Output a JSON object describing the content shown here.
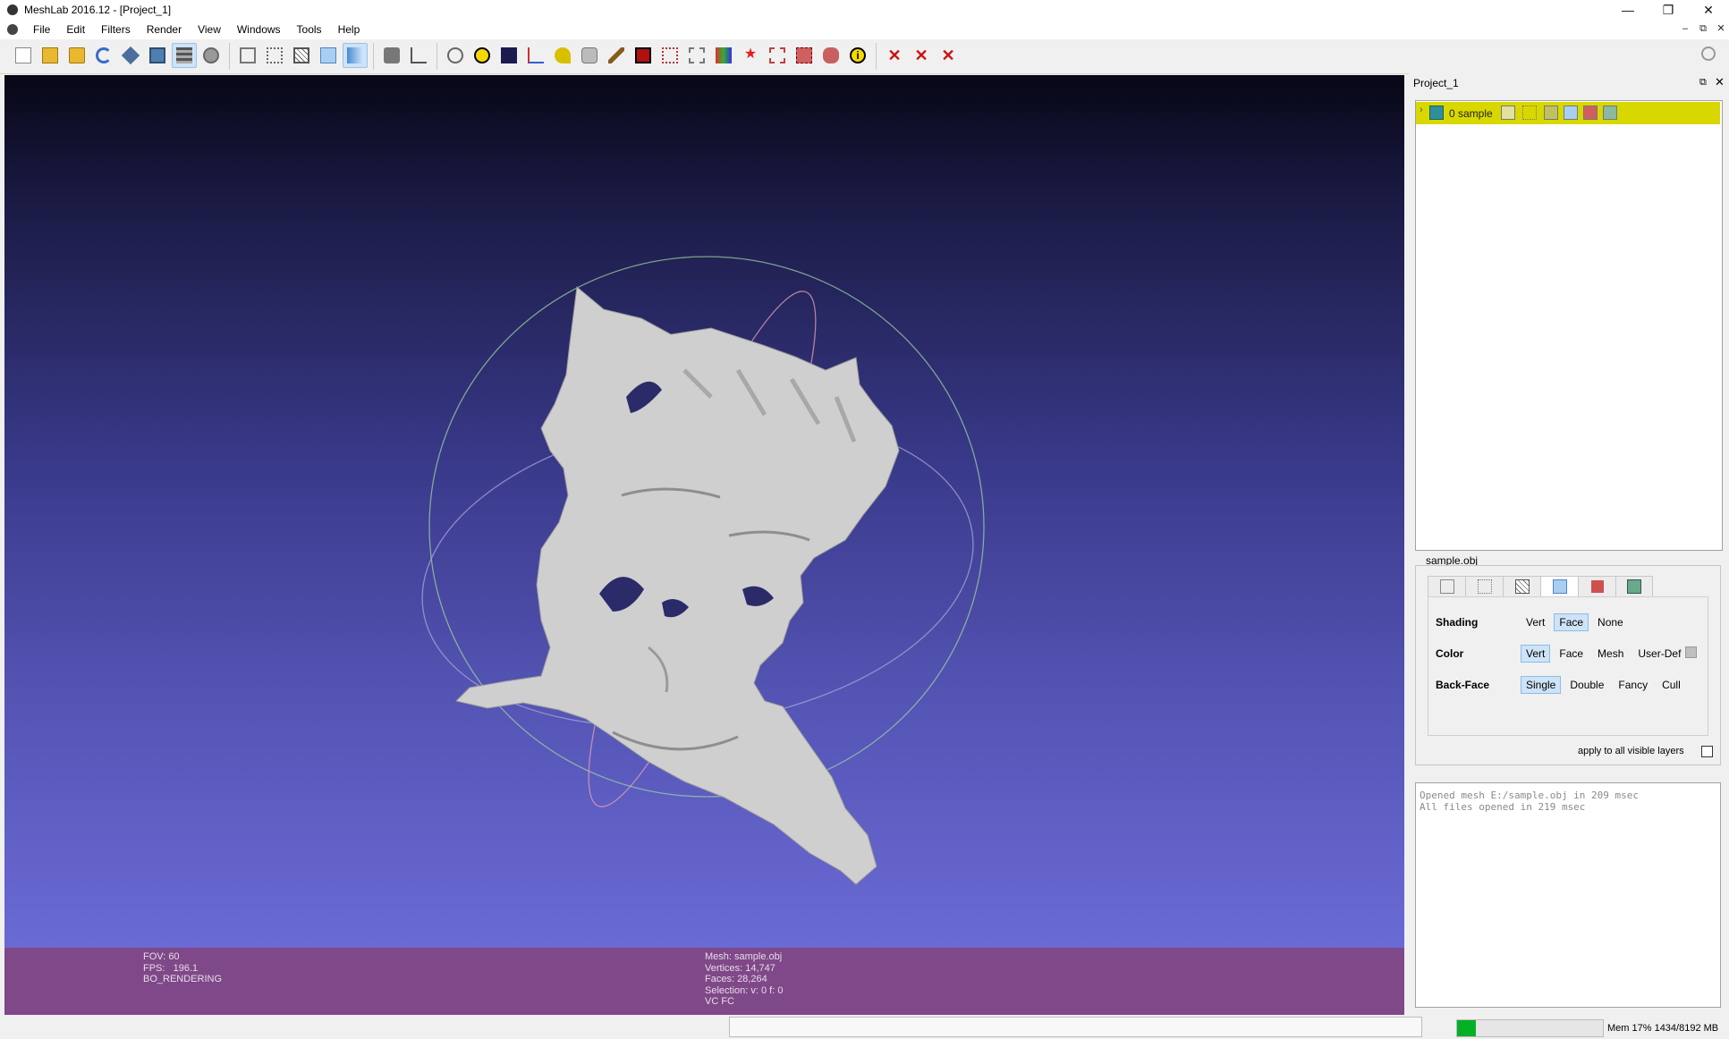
{
  "window": {
    "title": "MeshLab 2016.12 - [Project_1]",
    "minimize": "—",
    "restore": "❐",
    "close": "✕"
  },
  "menu": {
    "items": [
      "File",
      "Edit",
      "Filters",
      "Render",
      "View",
      "Windows",
      "Tools",
      "Help"
    ],
    "mdi_min": "–",
    "mdi_restore": "⧉",
    "mdi_close": "✕"
  },
  "toolbar": {
    "group1": [
      "new-project",
      "open-project",
      "import-mesh",
      "reload",
      "export-mesh",
      "snapshot",
      "show-layers",
      "show-raster"
    ],
    "group2": [
      "bbox",
      "points",
      "wireframe",
      "flat-lines",
      "flat",
      "smooth"
    ],
    "group3": [
      "light",
      "axis"
    ],
    "group4": [
      "trackball",
      "annotate",
      "shader",
      "axes",
      "paint-select",
      "measure",
      "brush",
      "pickpoints",
      "align",
      "align2",
      "texture",
      "georef",
      "select-vertex",
      "select-face",
      "select-connected",
      "select-conn2",
      "info"
    ],
    "group5": [
      "delete-v",
      "delete-f",
      "delete-all"
    ],
    "active": [
      "show-layers",
      "flat",
      "smooth"
    ]
  },
  "viewport": {
    "hud_left": [
      "FOV: 60",
      "FPS:   196.1",
      "BO_RENDERING"
    ],
    "hud_mid": [
      "Mesh: sample.obj",
      "Vertices: 14,747",
      "Faces: 28,264",
      "Selection: v: 0 f: 0",
      "VC FC"
    ]
  },
  "dock": {
    "title": "Project_1",
    "float": "⧉",
    "close": "✕",
    "layer": {
      "expander": "›",
      "name": "0  sample"
    }
  },
  "props": {
    "title": "sample.obj",
    "shading_label": "Shading",
    "shading_opts": [
      "Vert",
      "Face",
      "None"
    ],
    "shading_selected": "Face",
    "color_label": "Color",
    "color_opts": [
      "Vert",
      "Face",
      "Mesh",
      "User-Def"
    ],
    "color_selected": "Vert",
    "backface_label": "Back-Face",
    "backface_opts": [
      "Single",
      "Double",
      "Fancy",
      "Cull"
    ],
    "backface_selected": "Single",
    "apply_label": "apply to all visible layers"
  },
  "log": [
    "Opened mesh E:/sample.obj in 209 msec",
    "All files opened in 219 msec"
  ],
  "status": {
    "progress": 0.13,
    "mem": "Mem 17% 1434/8192 MB"
  },
  "colors": {
    "progress_fill": "#06b025",
    "hud_band": "#7f4888",
    "layer_selected": "#d8d800"
  }
}
